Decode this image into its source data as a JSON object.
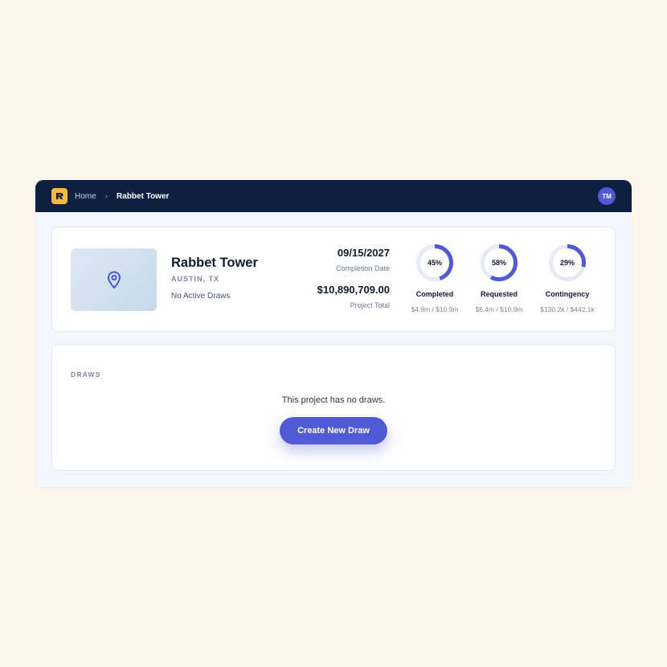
{
  "colors": {
    "page_bg": "#fdf6ec",
    "topbar_bg": "#0f2141",
    "accent": "#4f5ad4",
    "logo": "#f5b942",
    "ring_track": "#e6eaf2"
  },
  "topbar": {
    "logo_icon": "rabbet-logo-icon",
    "breadcrumb": {
      "home": "Home",
      "separator_icon": "chevron-right-icon",
      "current": "Rabbet Tower"
    },
    "avatar_initials": "TM"
  },
  "project": {
    "image_icon": "map-pin-icon",
    "name": "Rabbet Tower",
    "location": "AUSTIN, TX",
    "draws_status": "No Active Draws",
    "completion_date": "09/15/2027",
    "completion_date_label": "Completion Date",
    "project_total": "$10,890,709.00",
    "project_total_label": "Project Total",
    "gauges": [
      {
        "percent": 45,
        "percent_text": "45%",
        "label": "Completed",
        "sub": "$4.9m / $10.9m"
      },
      {
        "percent": 58,
        "percent_text": "58%",
        "label": "Requested",
        "sub": "$6.4m / $10.9m"
      },
      {
        "percent": 29,
        "percent_text": "29%",
        "label": "Contingency",
        "sub": "$130.2k / $442.1k"
      }
    ]
  },
  "draws": {
    "title": "DRAWS",
    "empty_message": "This project has no draws.",
    "create_button": "Create New Draw"
  }
}
